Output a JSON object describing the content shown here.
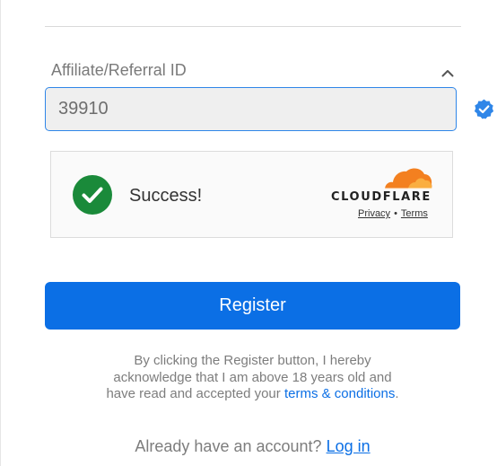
{
  "affiliate": {
    "label": "Affiliate/Referral ID",
    "value": "39910",
    "toggle_icon": "chevron-up-icon",
    "verified_icon": "verified-badge-icon"
  },
  "captcha": {
    "status_text": "Success!",
    "status_icon": "check-circle-icon",
    "brand": "CLOUDFLARE",
    "privacy_link": "Privacy",
    "separator": "•",
    "terms_link": "Terms"
  },
  "register": {
    "button_label": "Register",
    "disclaimer_line1": "By clicking the Register button, I hereby",
    "disclaimer_line2": "acknowledge that I am above 18 years old and",
    "disclaimer_line3": "have read and accepted your",
    "terms_link": "terms & conditions",
    "disclaimer_end": "."
  },
  "login": {
    "prompt": "Already have an account?",
    "link": "Log in"
  },
  "colors": {
    "accent": "#0b6fe5",
    "success": "#1a8a3a",
    "cloudflare_orange": "#f38020"
  }
}
